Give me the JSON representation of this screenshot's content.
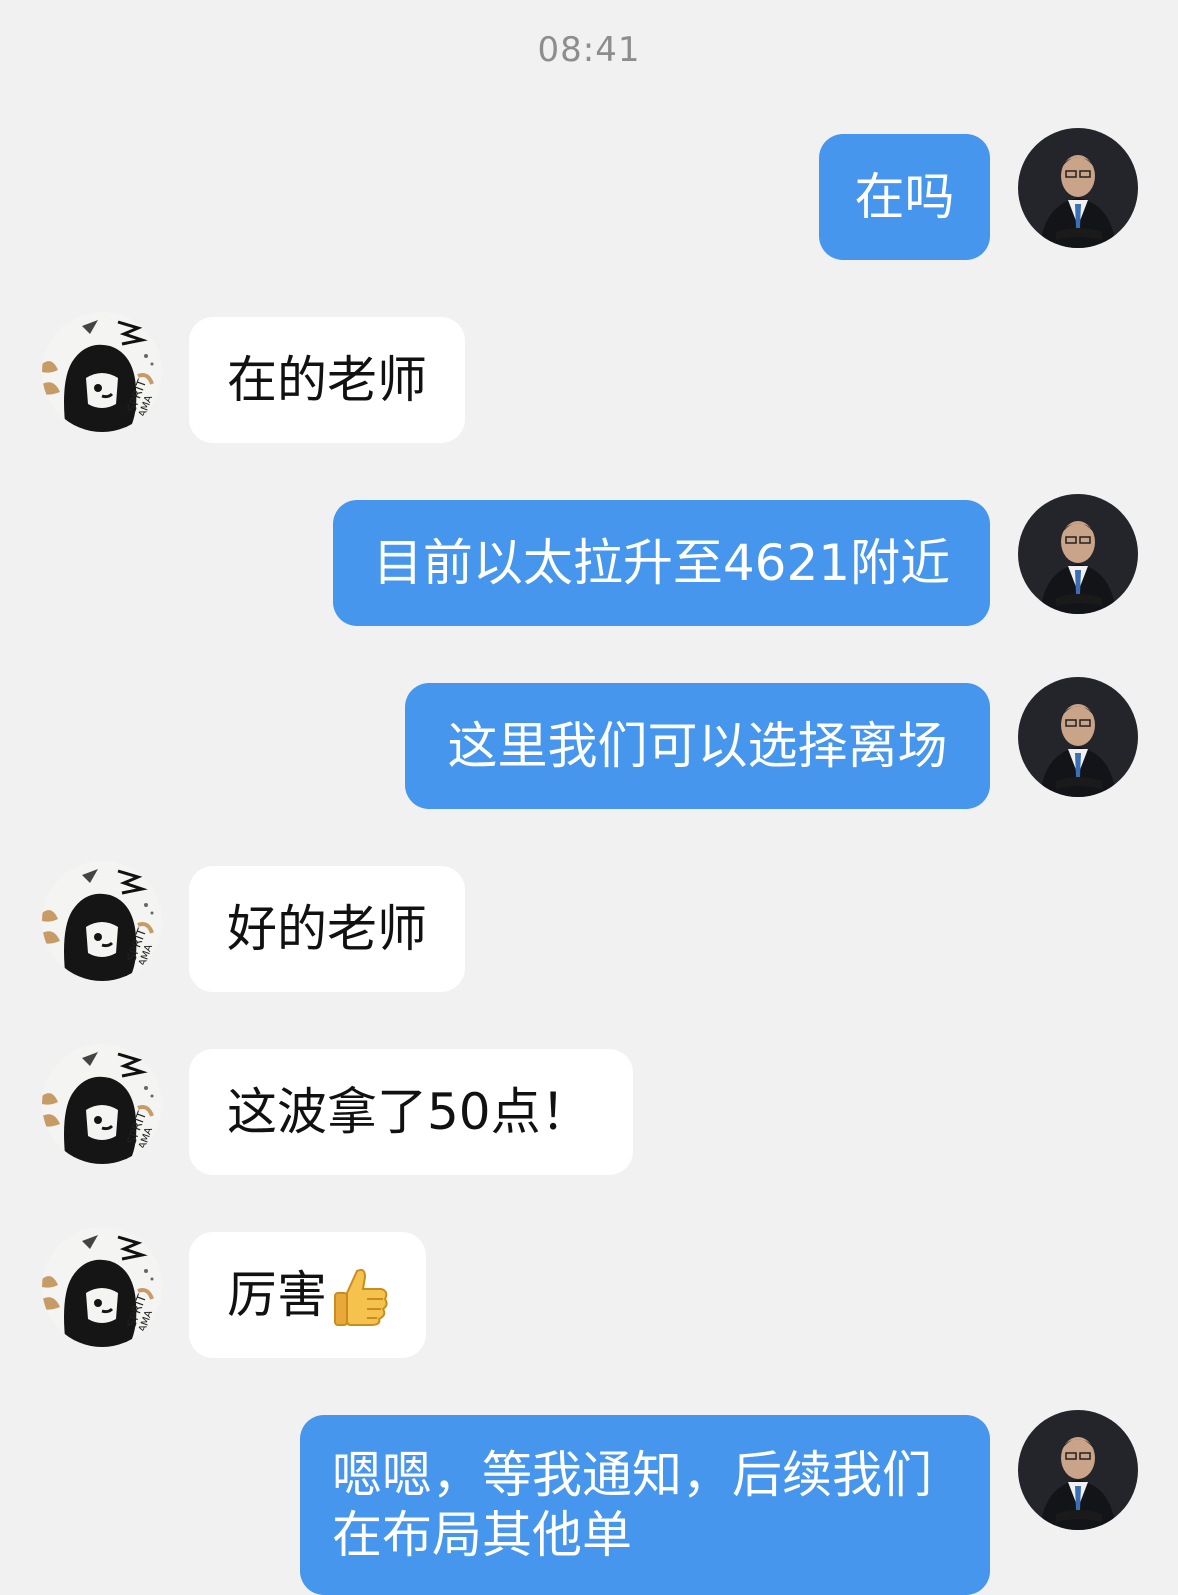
{
  "chat": {
    "timestamp": "08:41",
    "messages": [
      {
        "from": "outgoing",
        "text": "在吗"
      },
      {
        "from": "incoming",
        "text": "在的老师"
      },
      {
        "from": "outgoing",
        "text": "目前以太拉升至4621附近"
      },
      {
        "from": "outgoing",
        "text": "这里我们可以选择离场"
      },
      {
        "from": "incoming",
        "text": "好的老师"
      },
      {
        "from": "incoming",
        "text": "这波拿了50点！"
      },
      {
        "from": "incoming",
        "text": "厉害",
        "emoji": "thumbs-up-icon"
      },
      {
        "from": "outgoing",
        "text": "嗯嗯，等我通知，后续我们在布局其他单"
      }
    ]
  },
  "colors": {
    "background": "#f1f1f1",
    "outgoing_bubble": "#4596ec",
    "incoming_bubble": "#ffffff",
    "timestamp_text": "#8d8d8d"
  }
}
